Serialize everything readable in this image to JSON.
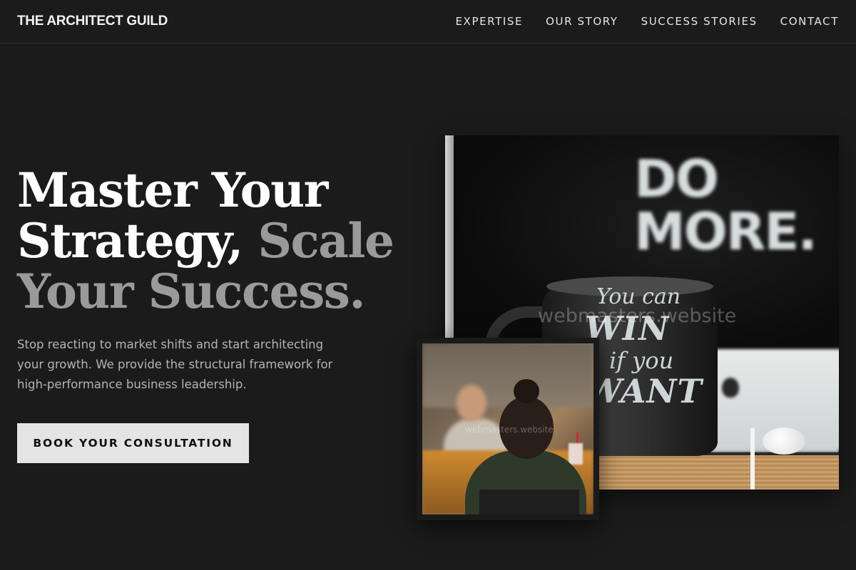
{
  "header": {
    "brand": "THE ARCHITECT GUILD",
    "nav": [
      {
        "label": "EXPERTISE"
      },
      {
        "label": "OUR STORY"
      },
      {
        "label": "SUCCESS STORIES"
      },
      {
        "label": "CONTACT"
      }
    ]
  },
  "hero": {
    "title_line1": "Master Your",
    "title_line2_a": "Strategy,",
    "title_line2_b": "Scale",
    "title_line3": "Your Success.",
    "subtitle": "Stop reacting to market shifts and start architecting your growth. We provide the structural framework for high-performance business leadership.",
    "cta_label": "BOOK YOUR CONSULTATION"
  },
  "images": {
    "main": {
      "wall_text_1": "DO",
      "wall_text_2": "MORE.",
      "mug_line1": "You can",
      "mug_line2": "WIN",
      "mug_line3": "if you",
      "mug_line4": "WANT",
      "watermark": "webmasters.website"
    },
    "small": {
      "watermark": "webmasters.website"
    }
  }
}
